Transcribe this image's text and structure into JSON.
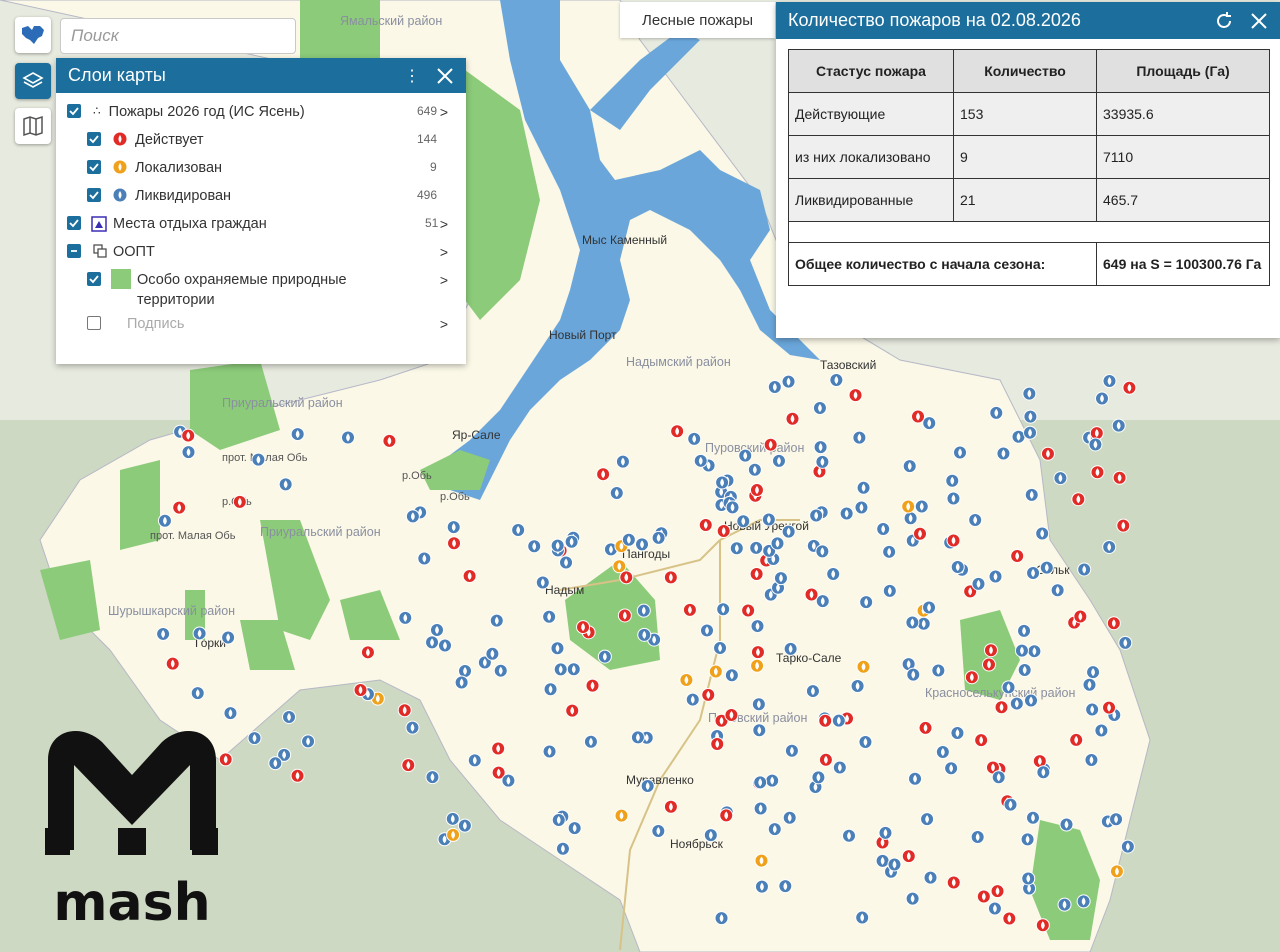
{
  "search": {
    "placeholder": "Поиск"
  },
  "layers_panel": {
    "title": "Слои карты",
    "layers": [
      {
        "label": "Пожары 2026 год (ИС Ясень)",
        "count": "649",
        "checked": true
      },
      {
        "label": "Действует",
        "count": "144",
        "checked": true,
        "icon": "fire-red-icon"
      },
      {
        "label": "Локализован",
        "count": "9",
        "checked": true,
        "icon": "fire-orange-icon"
      },
      {
        "label": "Ликвидирован",
        "count": "496",
        "checked": true,
        "icon": "fire-blue-icon"
      },
      {
        "label": "Места отдыха граждан",
        "count": "51",
        "checked": true,
        "icon": "rest-place-icon"
      },
      {
        "label": "ООПТ",
        "checked": "partial"
      },
      {
        "label": "Особо охраняемые природные территории",
        "checked": true,
        "icon": "green-square-icon"
      },
      {
        "label": "Подпись",
        "checked": false
      }
    ]
  },
  "tab": {
    "label": "Лесные пожары"
  },
  "stats": {
    "title": "Количество пожаров на 02.08.2026",
    "headers": [
      "Стастус пожара",
      "Количество",
      "Площадь (Га)"
    ],
    "rows": [
      {
        "status": "Действующие",
        "count": "153",
        "area": "33935.6"
      },
      {
        "status": "из них локализовано",
        "count": "9",
        "area": "7110"
      },
      {
        "status": "Ликвидированные",
        "count": "21",
        "area": "465.7"
      }
    ],
    "total_label": "Общее количество с начала сезона:",
    "total_value": "649 на S = 100300.76 Га"
  },
  "map_labels": {
    "yamal": "Ямальский район",
    "mys": "Мыс Каменный",
    "novy_port": "Новый Порт",
    "nadym_r": "Надымский район",
    "tazovsky": "Тазовский",
    "priural": "Приуральский район",
    "yar_sale": "Яр-Сале",
    "malaya_ob": "прот. Малая Обь",
    "r_ob1": "р.Обь",
    "r_ob2": "р.Обь",
    "r_ob3": "р.Обь",
    "priural2": "Приуральский район",
    "malaya_ob2": "прот. Малая Обь",
    "purovsky": "Пуровский район",
    "novy_urengoy": "Новый Уренгой",
    "pangody": "Пангоды",
    "nadym": "Надым",
    "shuryshkar": "Шурышкарский район",
    "gorki": "Горки",
    "tarko_sale": "Тарко-Сале",
    "purovsky2": "Пуровский район",
    "krasnoselkup": "Красноселькупский район",
    "selkup": "Сельк",
    "muravlenko": "Муравленко",
    "noyabrsk": "Ноябрьск"
  },
  "watermark": "mash",
  "fire_colors": {
    "active": "#e02b27",
    "localized": "#f0a11b",
    "extinguished": "#4a7fb8",
    "oopt": "#8ccb7a"
  }
}
